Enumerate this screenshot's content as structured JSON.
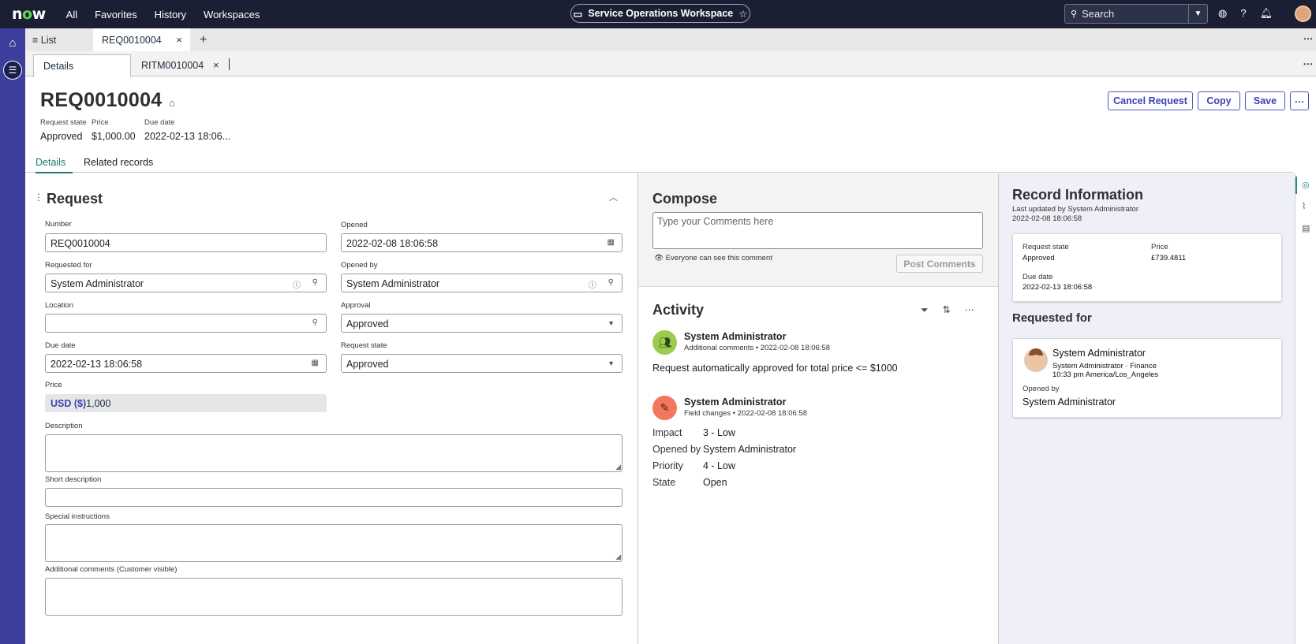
{
  "topbar": {
    "logo": "now",
    "nav": [
      "All",
      "Favorites",
      "History",
      "Workspaces"
    ],
    "workspace": "Service Operations Workspace",
    "search_placeholder": "Search"
  },
  "tabs": {
    "list_label": "List",
    "record_tab": "REQ0010004",
    "sub_tabs": [
      "Details",
      "RITM0010004"
    ]
  },
  "record": {
    "number": "REQ0010004",
    "header_fields": [
      {
        "label": "Request state",
        "value": "Approved"
      },
      {
        "label": "Price",
        "value": "$1,000.00"
      },
      {
        "label": "Due date",
        "value": "2022-02-13 18:06..."
      }
    ],
    "actions": [
      "Cancel Request",
      "Copy",
      "Save"
    ],
    "content_tabs": [
      "Details",
      "Related records"
    ]
  },
  "form": {
    "section_title": "Request",
    "number_label": "Number",
    "number_value": "REQ0010004",
    "opened_label": "Opened",
    "opened_value": "2022-02-08 18:06:58",
    "requested_for_label": "Requested for",
    "requested_for_value": "System Administrator",
    "opened_by_label": "Opened by",
    "opened_by_value": "System Administrator",
    "location_label": "Location",
    "location_value": "",
    "approval_label": "Approval",
    "approval_value": "Approved",
    "due_date_label": "Due date",
    "due_date_value": "2022-02-13 18:06:58",
    "request_state_label": "Request state",
    "request_state_value": "Approved",
    "price_label": "Price",
    "price_currency": "USD ($)",
    "price_value": "1,000",
    "description_label": "Description",
    "short_description_label": "Short description",
    "special_instructions_label": "Special instructions",
    "additional_comments_label": "Additional comments (Customer visible)"
  },
  "compose": {
    "title": "Compose",
    "placeholder": "Type your Comments here",
    "visibility": "Everyone can see this comment",
    "post_button": "Post Comments"
  },
  "activity": {
    "title": "Activity",
    "entries": [
      {
        "name": "System Administrator",
        "type": "Additional comments",
        "time": "2022-02-08 18:06:58",
        "text": "Request automatically approved for total price <= $1000"
      },
      {
        "name": "System Administrator",
        "type": "Field changes",
        "time": "2022-02-08 18:06:58"
      }
    ],
    "changes": [
      {
        "field": "Impact",
        "value": "3 - Low"
      },
      {
        "field": "Opened by",
        "value": "System Administrator"
      },
      {
        "field": "Priority",
        "value": "4 - Low"
      },
      {
        "field": "State",
        "value": "Open"
      }
    ]
  },
  "record_info": {
    "title": "Record Information",
    "updated_by": "Last updated by System Administrator",
    "updated_at": "2022-02-08 18:06:58",
    "request_state_label": "Request state",
    "request_state_value": "Approved",
    "price_label": "Price",
    "price_value": "£739.4811",
    "due_date_label": "Due date",
    "due_date_value": "2022-02-13 18:06:58",
    "requested_for_title": "Requested for",
    "person_name": "System Administrator",
    "person_role": "System Administrator · Finance",
    "person_time": "10:33 pm America/Los_Angeles",
    "opened_by_label": "Opened by",
    "opened_by_value": "System Administrator"
  },
  "colors": {
    "topbar": "#1b1f33",
    "rail": "#3b3f9b",
    "accent": "#3a44b6",
    "teal": "#1a7a6f",
    "logo_o": "#62d84e"
  }
}
